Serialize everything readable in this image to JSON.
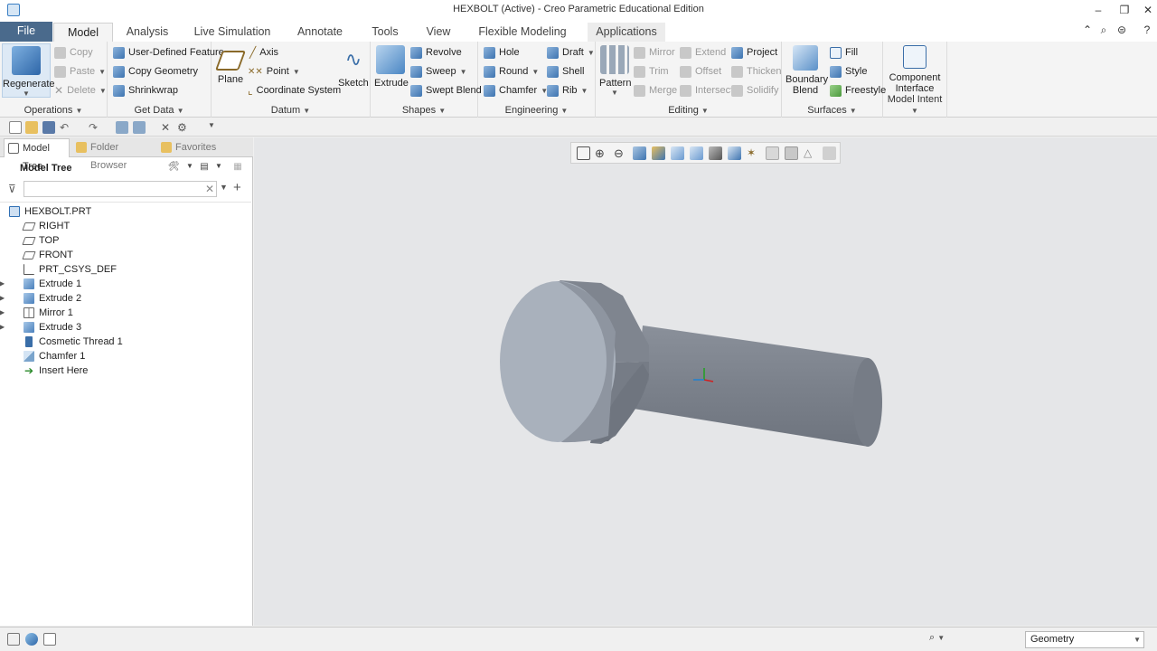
{
  "window": {
    "title": "HEXBOLT (Active) - Creo Parametric Educational Edition",
    "minimize": "–",
    "restore": "❐",
    "close": "✕"
  },
  "tabs": [
    "File",
    "Model",
    "Analysis",
    "Live Simulation",
    "Annotate",
    "Tools",
    "View",
    "Flexible Modeling",
    "Applications"
  ],
  "ribbon": {
    "operations": {
      "regenerate": "Regenerate",
      "copy": "Copy",
      "paste": "Paste",
      "delete": "Delete",
      "label": "Operations"
    },
    "get_data": {
      "udf": "User-Defined Feature",
      "copy_geometry": "Copy Geometry",
      "shrinkwrap": "Shrinkwrap",
      "label": "Get Data"
    },
    "datum": {
      "plane": "Plane",
      "axis": "Axis",
      "point": "Point",
      "csys": "Coordinate System",
      "sketch": "Sketch",
      "label": "Datum"
    },
    "shapes": {
      "extrude": "Extrude",
      "revolve": "Revolve",
      "sweep": "Sweep",
      "swept_blend": "Swept Blend",
      "label": "Shapes"
    },
    "engineering": {
      "hole": "Hole",
      "round": "Round",
      "chamfer": "Chamfer",
      "draft": "Draft",
      "shell": "Shell",
      "rib": "Rib",
      "label": "Engineering"
    },
    "editing": {
      "pattern": "Pattern",
      "mirror": "Mirror",
      "trim": "Trim",
      "merge": "Merge",
      "extend": "Extend",
      "offset": "Offset",
      "intersect": "Intersect",
      "project": "Project",
      "thicken": "Thicken",
      "solidify": "Solidify",
      "label": "Editing"
    },
    "surfaces": {
      "boundary_blend_1": "Boundary",
      "boundary_blend_2": "Blend",
      "fill": "Fill",
      "style": "Style",
      "freestyle": "Freestyle",
      "label": "Surfaces"
    },
    "model_intent": {
      "component_1": "Component",
      "component_2": "Interface",
      "label": "Model Intent"
    }
  },
  "panel": {
    "tabs": [
      "Model Tree",
      "Folder Browser",
      "Favorites"
    ],
    "title": "Model Tree",
    "filter_placeholder": "",
    "tree": [
      {
        "label": "HEXBOLT.PRT",
        "icon": "part-icon",
        "expandable": false,
        "level": 0
      },
      {
        "label": "RIGHT",
        "icon": "datum-plane-icon",
        "expandable": false,
        "level": 1
      },
      {
        "label": "TOP",
        "icon": "datum-plane-icon",
        "expandable": false,
        "level": 1
      },
      {
        "label": "FRONT",
        "icon": "datum-plane-icon",
        "expandable": false,
        "level": 1
      },
      {
        "label": "PRT_CSYS_DEF",
        "icon": "csys-icon",
        "expandable": false,
        "level": 1
      },
      {
        "label": "Extrude 1",
        "icon": "extrude-icon",
        "expandable": true,
        "level": 1
      },
      {
        "label": "Extrude 2",
        "icon": "extrude-icon",
        "expandable": true,
        "level": 1
      },
      {
        "label": "Mirror 1",
        "icon": "mirror-icon",
        "expandable": true,
        "level": 1
      },
      {
        "label": "Extrude 3",
        "icon": "extrude-icon",
        "expandable": true,
        "level": 1
      },
      {
        "label": "Cosmetic Thread 1",
        "icon": "thread-icon",
        "expandable": false,
        "level": 1
      },
      {
        "label": "Chamfer 1",
        "icon": "chamfer-icon",
        "expandable": false,
        "level": 1
      },
      {
        "label": "Insert Here",
        "icon": "insert-arrow-icon",
        "expandable": false,
        "level": 1
      }
    ]
  },
  "status": {
    "selection_filter": "Geometry"
  },
  "colors": {
    "file_tab": "#4a6a8c",
    "viewport_bg": "#e5e6e8",
    "model_shade": "#7d838e",
    "head_face": "#a9b1bc"
  }
}
